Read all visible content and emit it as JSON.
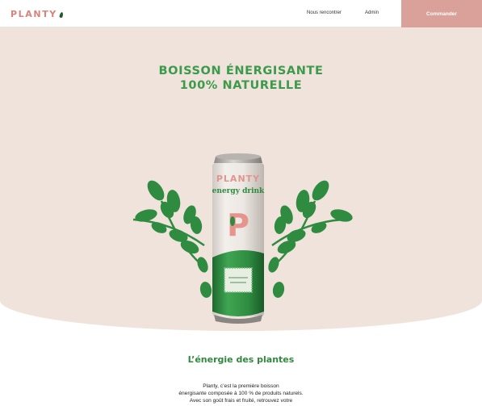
{
  "header": {
    "logo_text": "PLANTY",
    "nav": {
      "rencontrer": "Nous rencontrer",
      "admin": "Admin"
    },
    "order_label": "Commander"
  },
  "hero": {
    "title_line1": "BOISSON ÉNERGISANTE",
    "title_line2": "100% NATURELLE",
    "can": {
      "brand": "PLANTY",
      "subtitle": "energy drink",
      "letter": "P"
    }
  },
  "content": {
    "title": "L’énergie des plantes",
    "body_lines": [
      "Planty, c’est la première boisson",
      "énergisante composée à 100 % de produits naturels.",
      "Avec son goût frais et fruité, retrouvez votre"
    ]
  },
  "colors": {
    "brand_pink": "#d9827a",
    "button_pink": "#d9a19a",
    "green": "#3c9a4a",
    "hero_bg": "#efe3db",
    "leaf_green": "#2e8b3f"
  }
}
